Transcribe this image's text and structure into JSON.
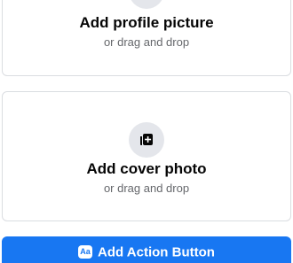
{
  "profile_upload": {
    "title": "Add profile picture",
    "subtitle": "or drag and drop",
    "icon": "add-photo-icon"
  },
  "cover_upload": {
    "title": "Add cover photo",
    "subtitle": "or drag and drop",
    "icon": "add-cover-photo-icon"
  },
  "action_button": {
    "label": "Add Action Button",
    "icon_text": "Aa",
    "color": "#1877f2"
  }
}
